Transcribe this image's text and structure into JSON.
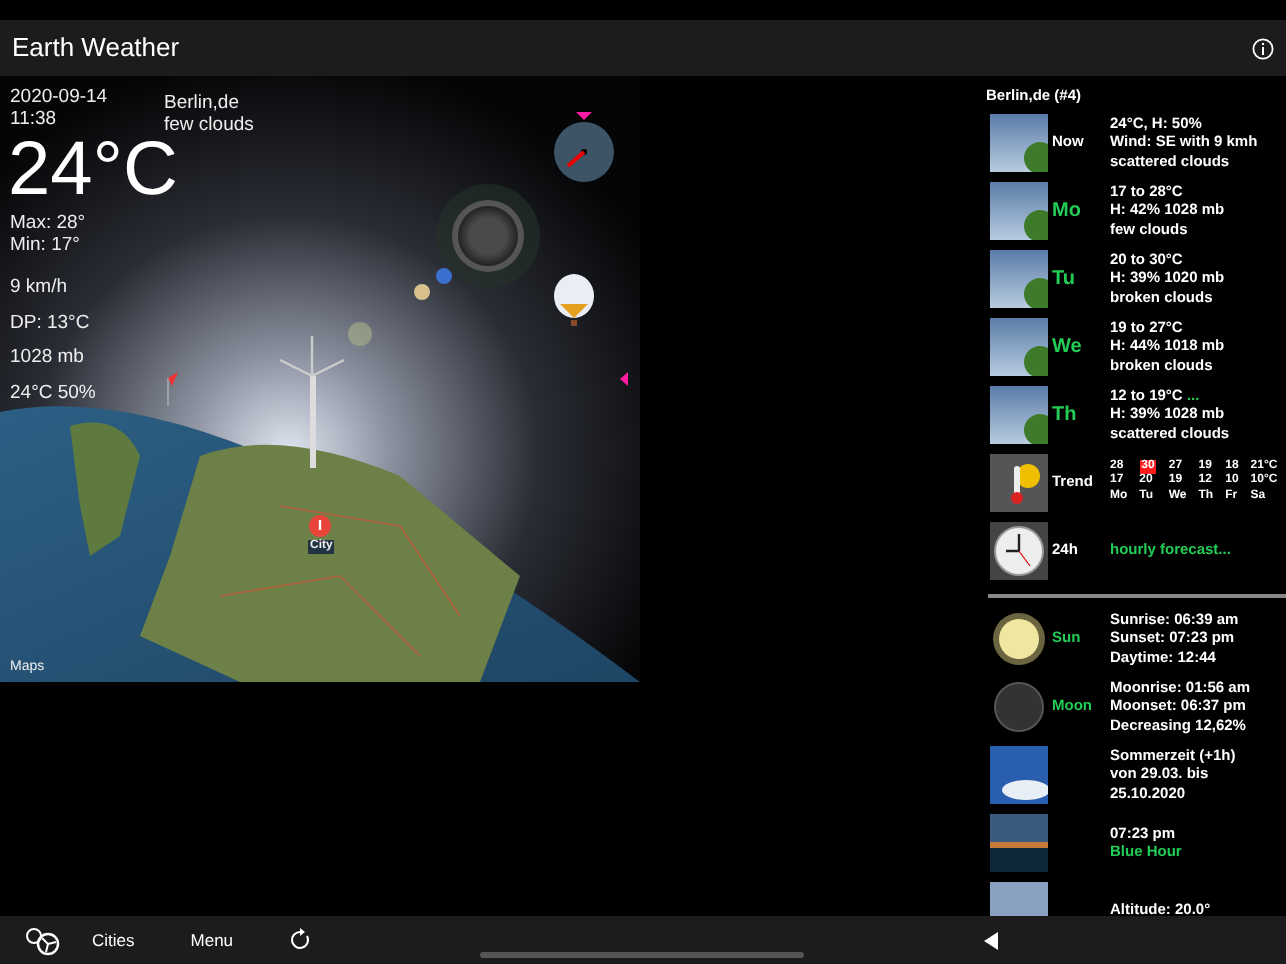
{
  "window": {
    "title": "Earth Weather"
  },
  "current": {
    "date": "2020-09-14",
    "time": "11:38",
    "location": "Berlin,de",
    "condition": "few clouds",
    "temperature": "24°C",
    "max": "Max: 28°",
    "min": "Min: 17°",
    "wind": "9 km/h",
    "dew_point": "DP: 13°C",
    "pressure": "1028 mb",
    "indoor": "24°C 50%"
  },
  "map": {
    "pin_label": "City",
    "attribution": "Maps"
  },
  "forecast": {
    "title": "Berlin,de (#4)",
    "rows": [
      {
        "kind": "sky",
        "label": "Now",
        "color": "#ffffff",
        "lines": [
          {
            "text": "24°C, H: 50%"
          },
          {
            "text": "Wind: SE with 9 kmh"
          },
          {
            "text": "scattered clouds"
          }
        ]
      },
      {
        "kind": "sky",
        "label": "Mo",
        "color": "#22cc55",
        "lines": [
          {
            "text": "17 to 28°C"
          },
          {
            "text": "H: 42% 1028 mb"
          },
          {
            "text": "few clouds"
          }
        ]
      },
      {
        "kind": "sky",
        "label": "Tu",
        "color": "#22cc55",
        "lines": [
          {
            "text": "20 to 30°C"
          },
          {
            "text": "H: 39% 1020 mb"
          },
          {
            "text": "broken clouds"
          }
        ]
      },
      {
        "kind": "sky",
        "label": "We",
        "color": "#22cc55",
        "lines": [
          {
            "text": "19 to 27°C"
          },
          {
            "text": "H: 44% 1018 mb"
          },
          {
            "text": "broken clouds"
          }
        ]
      },
      {
        "kind": "sky",
        "label": "Th",
        "color": "#22cc55",
        "lines": [
          {
            "text": "12 to 19°C",
            "suffix": "..."
          },
          {
            "text": "H: 39% 1028 mb"
          },
          {
            "text": "scattered clouds"
          }
        ]
      },
      {
        "kind": "trend",
        "label": "Trend",
        "color": "#ffffff",
        "trend": [
          {
            "high": "28",
            "low": "17",
            "day": "Mo",
            "highlighted": false
          },
          {
            "high": "30",
            "low": "20",
            "day": "Tu",
            "highlighted": true
          },
          {
            "high": "27",
            "low": "19",
            "day": "We",
            "highlighted": false
          },
          {
            "high": "19",
            "low": "12",
            "day": "Th",
            "highlighted": false
          },
          {
            "high": "18",
            "low": "10",
            "day": "Fr",
            "highlighted": false
          },
          {
            "high": "21°C",
            "low": "10°C",
            "day": "Sa",
            "highlighted": false
          }
        ]
      },
      {
        "kind": "clock",
        "label": "24h",
        "color": "#ffffff",
        "link": "hourly forecast..."
      }
    ]
  },
  "astro": {
    "rows": [
      {
        "kind": "sun",
        "label": "Sun",
        "color": "#22cc55",
        "lines": [
          {
            "text": "Sunrise: 06:39 am"
          },
          {
            "text": "Sunset: 07:23 pm"
          },
          {
            "text": "Daytime: 12:44"
          }
        ]
      },
      {
        "kind": "moon",
        "label": "Moon",
        "color": "#22cc55",
        "lines": [
          {
            "text": "Moonrise: 01:56 am"
          },
          {
            "text": "Moonset: 06:37 pm"
          },
          {
            "text": "Decreasing 12,62%"
          }
        ]
      },
      {
        "kind": "clouds",
        "lines": [
          {
            "text": "Sommerzeit (+1h)"
          },
          {
            "text": "von 29.03. bis"
          },
          {
            "text": "25.10.2020"
          }
        ]
      },
      {
        "kind": "dusk",
        "lines": [
          {
            "text": "07:23 pm"
          },
          {
            "text": "Blue Hour",
            "green": true
          }
        ]
      },
      {
        "kind": "iss",
        "lines": [
          {
            "text": "Altitude: 20.0°"
          }
        ]
      }
    ]
  },
  "toolbar": {
    "items": [
      "Cities",
      "Menu"
    ]
  }
}
